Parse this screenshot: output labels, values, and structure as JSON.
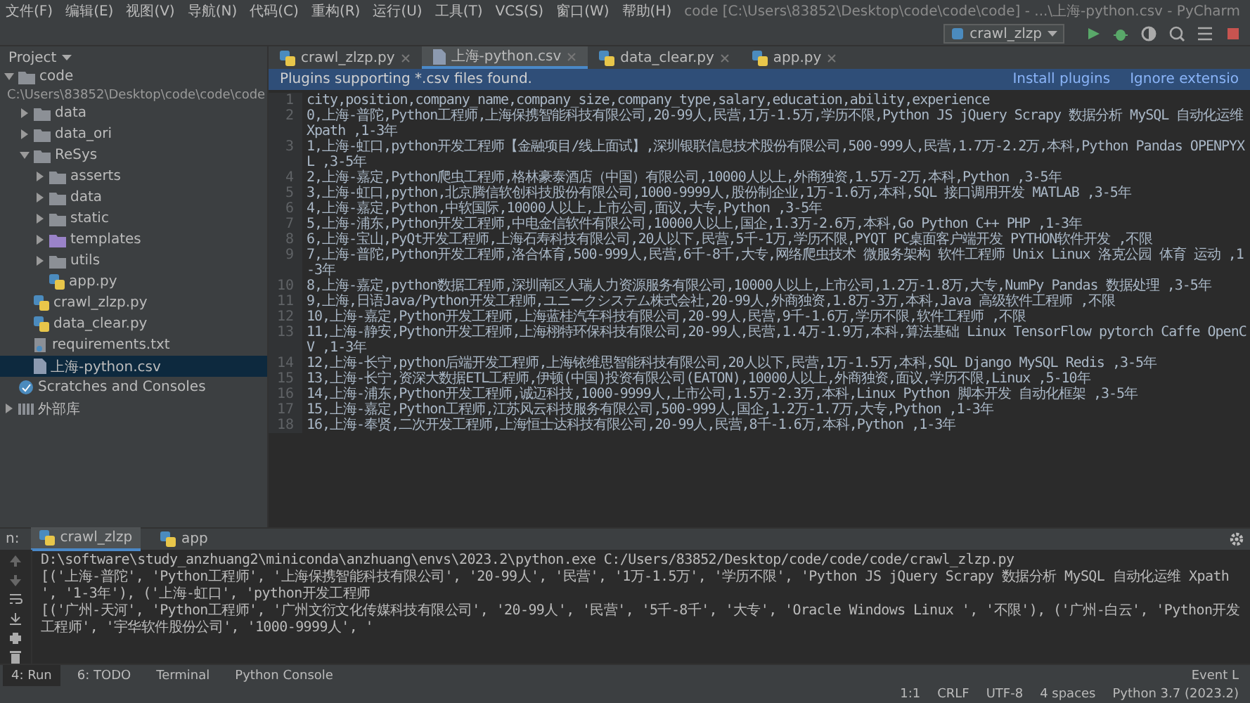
{
  "window": {
    "title": "code [C:\\Users\\83852\\Desktop\\code\\code\\code] - ...\\上海-python.csv - PyCharm"
  },
  "menu": [
    "文件(F)",
    "编辑(E)",
    "视图(V)",
    "导航(N)",
    "代码(C)",
    "重构(R)",
    "运行(U)",
    "工具(T)",
    "VCS(S)",
    "窗口(W)",
    "帮助(H)"
  ],
  "run_config": "crawl_zlzp",
  "project_panel": {
    "title": "Project",
    "tree": [
      {
        "label": "code",
        "path": "C:\\Users\\83852\\Desktop\\code\\code\\code",
        "kind": "folder",
        "expanded": true,
        "selected": false,
        "children": [
          {
            "label": "data",
            "kind": "folder",
            "expanded": false,
            "selected": false
          },
          {
            "label": "data_ori",
            "kind": "folder",
            "expanded": false,
            "selected": false
          },
          {
            "label": "ReSys",
            "kind": "folder",
            "expanded": true,
            "selected": false,
            "children": [
              {
                "label": "asserts",
                "kind": "folder",
                "expanded": false,
                "selected": false
              },
              {
                "label": "data",
                "kind": "folder",
                "expanded": false,
                "selected": false
              },
              {
                "label": "static",
                "kind": "folder",
                "expanded": false,
                "selected": false
              },
              {
                "label": "templates",
                "kind": "template-folder",
                "expanded": false,
                "selected": false
              },
              {
                "label": "utils",
                "kind": "folder",
                "expanded": false,
                "selected": false
              },
              {
                "label": "app.py",
                "kind": "python",
                "selected": false
              }
            ]
          },
          {
            "label": "crawl_zlzp.py",
            "kind": "python",
            "selected": false
          },
          {
            "label": "data_clear.py",
            "kind": "python",
            "selected": false
          },
          {
            "label": "requirements.txt",
            "kind": "text",
            "selected": false
          },
          {
            "label": "上海-python.csv",
            "kind": "csv",
            "selected": true
          }
        ]
      },
      {
        "label": "Scratches and Consoles",
        "kind": "scratch",
        "selected": false
      },
      {
        "label": "外部库",
        "kind": "library",
        "expanded": false,
        "selected": false
      }
    ]
  },
  "editor_tabs": [
    {
      "label": "crawl_zlzp.py",
      "kind": "python",
      "selected": false
    },
    {
      "label": "上海-python.csv",
      "kind": "csv",
      "selected": true
    },
    {
      "label": "data_clear.py",
      "kind": "python",
      "selected": false
    },
    {
      "label": "app.py",
      "kind": "python",
      "selected": false
    }
  ],
  "notification": {
    "message": "Plugins supporting *.csv files found.",
    "actions": [
      "Install plugins",
      "Ignore extensio"
    ]
  },
  "editor_lines": [
    {
      "number": "1",
      "text": "city,position,company_name,company_size,company_type,salary,education,ability,experience"
    },
    {
      "number": "2",
      "text": "0,上海-普陀,Python工程师,上海保携智能科技有限公司,20-99人,民营,1万-1.5万,学历不限,Python JS jQuery Scrapy 数据分析 MySQL 自动化运维 Xpath ,1-3年"
    },
    {
      "number": "3",
      "text": "1,上海-虹口,python开发工程师【金融项目/线上面试】,深圳银联信息技术股份有限公司,500-999人,民营,1.7万-2.2万,本科,Python Pandas OPENPYXL ,3-5年"
    },
    {
      "number": "4",
      "text": "2,上海-嘉定,Python爬虫工程师,格林豪泰酒店（中国）有限公司,10000人以上,外商独资,1.5万-2万,本科,Python ,3-5年"
    },
    {
      "number": "5",
      "text": "3,上海-虹口,python,北京腾信软创科技股份有限公司,1000-9999人,股份制企业,1万-1.6万,本科,SQL 接口调用开发 MATLAB ,3-5年"
    },
    {
      "number": "6",
      "text": "4,上海-嘉定,Python,中软国际,10000人以上,上市公司,面议,大专,Python ,3-5年"
    },
    {
      "number": "7",
      "text": "5,上海-浦东,Python开发工程师,中电金信软件有限公司,10000人以上,国企,1.3万-2.6万,本科,Go Python C++ PHP ,1-3年"
    },
    {
      "number": "8",
      "text": "6,上海-宝山,PyQt开发工程师,上海石寿科技有限公司,20人以下,民营,5千-1万,学历不限,PYQT PC桌面客户端开发 PYTHON软件开发 ,不限"
    },
    {
      "number": "9",
      "text": "7,上海-普陀,Python开发工程师,洛合体育,500-999人,民营,6千-8千,大专,网络爬虫技术 微服务架构 软件工程师 Unix Linux 洛克公园 体育 运动 ,1-3年"
    },
    {
      "number": "10",
      "text": "8,上海-嘉定,python数据工程师,深圳南区人瑞人力资源服务有限公司,10000人以上,上市公司,1.2万-1.8万,大专,NumPy Pandas 数据处理 ,3-5年"
    },
    {
      "number": "11",
      "text": "9,上海,日语Java/Python开发工程师,ユニークシステム株式会社,20-99人,外商独资,1.8万-3万,本科,Java 高级软件工程师 ,不限"
    },
    {
      "number": "12",
      "text": "10,上海-嘉定,Python开发工程师,上海蓝桂汽车科技有限公司,20-99人,民营,9千-1.6万,学历不限,软件工程师 ,不限"
    },
    {
      "number": "13",
      "text": "11,上海-静安,Python开发工程师,上海栩特环保科技有限公司,20-99人,民营,1.4万-1.9万,本科,算法基础 Linux TensorFlow pytorch Caffe OpenCV ,1-3年"
    },
    {
      "number": "14",
      "text": "12,上海-长宁,python后端开发工程师,上海铱维思智能科技有限公司,20人以下,民营,1万-1.5万,本科,SQL Django MySQL Redis ,3-5年"
    },
    {
      "number": "15",
      "text": "13,上海-长宁,资深大数据ETL工程师,伊顿(中国)投资有限公司(EATON),10000人以上,外商独资,面议,学历不限,Linux ,5-10年"
    },
    {
      "number": "16",
      "text": "14,上海-浦东,Python开发工程师,诚迈科技,1000-9999人,上市公司,1.5万-2.3万,本科,Linux Python 脚本开发 自动化框架 ,3-5年"
    },
    {
      "number": "17",
      "text": "15,上海-嘉定,Python工程师,江苏风云科技服务有限公司,500-999人,国企,1.2万-1.7万,大专,Python ,1-3年"
    },
    {
      "number": "18",
      "text": "16,上海-奉贤,二次开发工程师,上海恒士达科技有限公司,20-99人,民营,8千-1.6万,本科,Python ,1-3年"
    }
  ],
  "run_panel": {
    "label": "n:",
    "tabs": [
      {
        "label": "crawl_zlzp",
        "selected": true
      },
      {
        "label": "app",
        "selected": false
      }
    ],
    "output": [
      "D:\\software\\study_anzhuang2\\miniconda\\anzhuang\\envs\\2023.2\\python.exe C:/Users/83852/Desktop/code/code/code/crawl_zlzp.py",
      "[('上海-普陀', 'Python工程师', '上海保携智能科技有限公司', '20-99人', '民营', '1万-1.5万', '学历不限', 'Python JS jQuery Scrapy 数据分析 MySQL 自动化运维 Xpath ', '1-3年'), ('上海-虹口', 'python开发工程师",
      "[('广州-天河', 'Python工程师', '广州文衍文化传媒科技有限公司', '20-99人', '民营', '5千-8千', '大专', 'Oracle Windows Linux ', '不限'), ('广州-白云', 'Python开发工程师', '宇华软件股份公司', '1000-9999人', '"
    ]
  },
  "tool_windows": [
    {
      "label": "4: Run",
      "selected": true
    },
    {
      "label": "6: TODO",
      "selected": false
    },
    {
      "label": "Terminal",
      "selected": false
    },
    {
      "label": "Python Console",
      "selected": false
    }
  ],
  "event_log": "Event L",
  "status_bar": [
    "1:1",
    "CRLF",
    "UTF-8",
    "4 spaces",
    "Python 3.7 (2023.2)"
  ]
}
